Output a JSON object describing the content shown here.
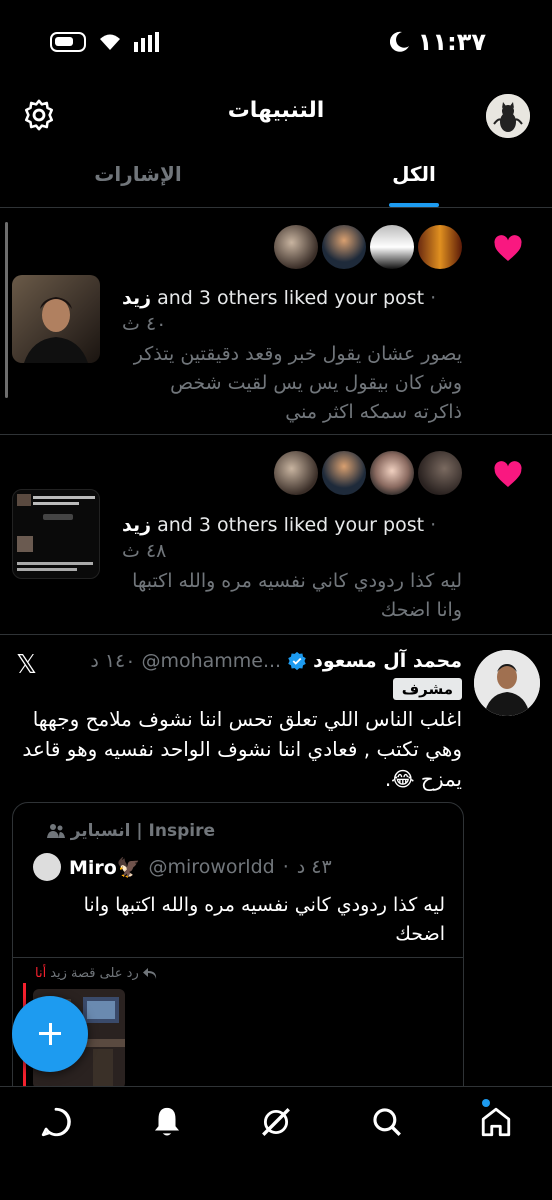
{
  "status_bar": {
    "time": "١١:٣٧"
  },
  "header": {
    "title": "التنبيهات"
  },
  "tabs": [
    {
      "label": "الإشارات",
      "active": false
    },
    {
      "label": "الكل",
      "active": true
    }
  ],
  "notifications": [
    {
      "actor": "زيد",
      "action": "and 3 others liked your post",
      "time": "· ٤٠ ث",
      "preview": "يصور عشان يقول خبر وقعد دقيقتين يتذكر وش كان بيقول يس يس لقيت شخص ذاكرته سمكه اكثر مني"
    },
    {
      "actor": "زيد",
      "action": "and 3 others liked your post",
      "time": "· ٤٨ ث",
      "preview": "ليه كذا ردودي كاني نفسيه مره والله اكتبها وانا اضحك"
    }
  ],
  "mention": {
    "name": "محمد آل مسعود",
    "handle": "@mohamme...",
    "time": "١٤٠ د",
    "badge": "مشرف",
    "text": "اغلب الناس اللي تعلق تحس اننا نشوف ملامح وجهها وهي تكتب , فعادي اننا نشوف الواحد نفسيه وهو قاعد يمزح 😂.",
    "quote": {
      "community": "انسباير | Inspire",
      "name": "Miro🦅",
      "handle": "@miroworldd",
      "time": "٤٣ د",
      "text": "ليه كذا ردودي كاني نفسيه مره والله اكتبها وانا اضحك",
      "reply_prefix": "رد على قصة زيد",
      "reply_me": "أنا"
    }
  },
  "colors": {
    "accent": "#1d9bf0",
    "like": "#f91880",
    "background": "#000000"
  }
}
